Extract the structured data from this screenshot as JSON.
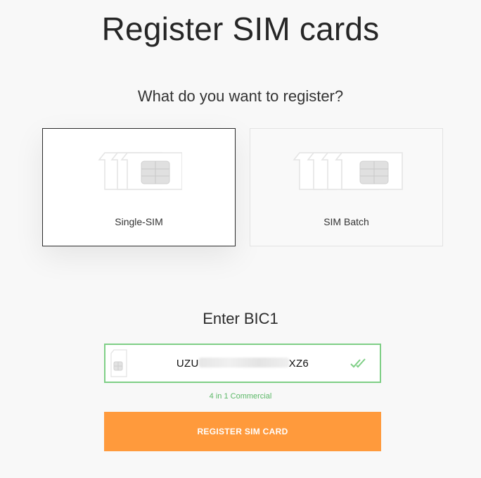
{
  "page": {
    "title": "Register SIM cards",
    "subtitle": "What do you want to register?"
  },
  "options": [
    {
      "label": "Single-SIM",
      "icon": "single-sim-icon",
      "selected": true
    },
    {
      "label": "SIM Batch",
      "icon": "sim-batch-icon",
      "selected": false
    }
  ],
  "bic": {
    "heading": "Enter BIC1",
    "value_prefix": "UZU",
    "value_suffix": "XZ6",
    "hint": "4 in 1 Commercial",
    "valid_color": "#7fcf86"
  },
  "actions": {
    "register_label": "REGISTER SIM CARD",
    "accent": "#ff9a3c"
  }
}
